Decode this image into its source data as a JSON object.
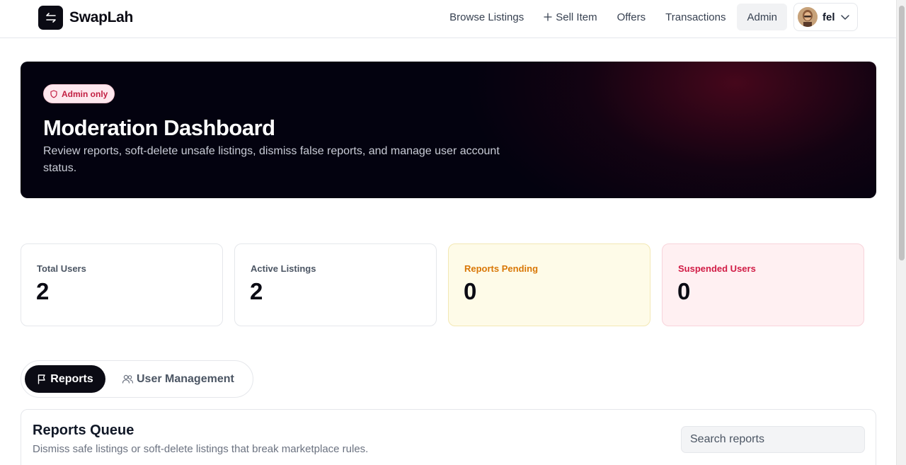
{
  "brand": {
    "name": "SwapLah"
  },
  "nav": {
    "browse": "Browse Listings",
    "sell": "Sell Item",
    "offers": "Offers",
    "transactions": "Transactions",
    "admin": "Admin",
    "user_name": "fel"
  },
  "hero": {
    "badge": "Admin only",
    "title": "Moderation Dashboard",
    "subtitle": "Review reports, soft-delete unsafe listings, dismiss false reports, and manage user account status."
  },
  "stats": [
    {
      "label": "Total Users",
      "value": "2"
    },
    {
      "label": "Active Listings",
      "value": "2"
    },
    {
      "label": "Reports Pending",
      "value": "0"
    },
    {
      "label": "Suspended Users",
      "value": "0"
    }
  ],
  "tabs": {
    "reports": "Reports",
    "users": "User Management"
  },
  "queue": {
    "title": "Reports Queue",
    "subtitle": "Dismiss safe listings or soft-delete listings that break marketplace rules.",
    "search_placeholder": "Search reports",
    "search_value": ""
  },
  "colors": {
    "primary": "#0b0b14",
    "hero_bg": "#03020f",
    "warning": "#d97706",
    "danger": "#d11b45"
  },
  "icons": {
    "logo": "swap-arrows-icon",
    "sell": "plus-icon",
    "menu": "chevron-down-icon",
    "badge": "shield-icon",
    "reports_tab": "flag-icon",
    "users_tab": "users-icon"
  }
}
